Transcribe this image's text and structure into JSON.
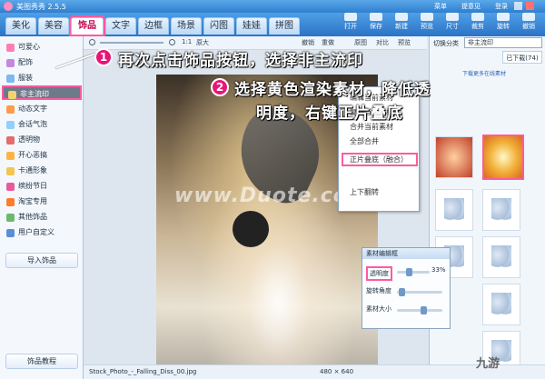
{
  "app": {
    "title": "美图秀秀 2.5.5",
    "right_labels": [
      "菜单",
      "提意见",
      "登录"
    ]
  },
  "tabs": [
    "美化",
    "美容",
    "饰品",
    "文字",
    "边框",
    "场景",
    "闪图",
    "娃娃",
    "拼图"
  ],
  "toolbar_buttons": [
    "打开",
    "保存",
    "新建",
    "预览",
    "尺寸",
    "裁剪",
    "旋转",
    "撤销"
  ],
  "sidebar": {
    "items": [
      "可爱心",
      "配饰",
      "服装",
      "非主流印",
      "动态文字",
      "会话气泡",
      "透明物",
      "开心恶搞",
      "卡通形象",
      "缤纷节日",
      "淘宝专用",
      "其他饰品",
      "用户自定义"
    ],
    "import_button": "导入饰品",
    "tutorial_button": "饰品教程"
  },
  "canvas_toolbar": {
    "zoom": "1:1",
    "zoom_label": "原大",
    "undo": "撤销",
    "redo": "重做",
    "reset": "原图",
    "compare": "对比",
    "preview": "预览"
  },
  "watermark": "www.Duote.com",
  "context_menu": {
    "items": [
      "编辑当前素材",
      "复制当前素材",
      "合并当前素材",
      "全部合并",
      "正片叠底（融合）",
      "上下翻转"
    ],
    "partial_top": "素材编辑框"
  },
  "right_panel": {
    "category_label": "切换分类",
    "category_value": "非主流印",
    "link": "下载更多在线素材",
    "tab_downloaded": "已下载(74)"
  },
  "material_editor": {
    "title": "素材编辑框",
    "transparency_label": "透明度",
    "transparency_value": "33%",
    "rotate_label": "旋转角度",
    "size_label": "素材大小"
  },
  "annotations": {
    "step1_number": "1",
    "step1_text": "再次点击饰品按钮，选择非主流印",
    "step2_number": "2",
    "step2_line1": "选择黄色渲染素材，降低透",
    "step2_line2": "明度，右键正片叠底"
  },
  "status": {
    "filename": "Stock_Photo_-_Falling_Diss_00.jpg",
    "size": "480 × 640"
  },
  "brand": "九游"
}
